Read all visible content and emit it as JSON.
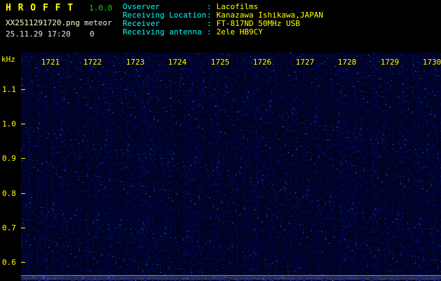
{
  "header": {
    "app_title": "H R O F F T",
    "version": "1.0.0",
    "filename": "XX2511291720.png",
    "mode": "meteor",
    "timestamp": "25.11.29 17:20",
    "echo_count": "0",
    "separator": ":",
    "info_rows": [
      {
        "label": "Ovserver",
        "value": "Lacofilms"
      },
      {
        "label": "Receiving Location",
        "value": "Kanazawa Ishikawa,JAPAN"
      },
      {
        "label": "Receiver",
        "value": "FT-817ND 50MHz USB"
      },
      {
        "label": "Receiving antenna",
        "value": "2ele HB9CY"
      }
    ]
  },
  "chart_data": {
    "type": "heatmap",
    "description": "10-minute radio meteor spectrogram waterfall showing only blue noise floor, no meteor echoes; faint horizontal carrier lines and blue signal-level trace along bottom edge",
    "x_ticks": [
      "1721",
      "1722",
      "1723",
      "1724",
      "1725",
      "1726",
      "1727",
      "1728",
      "1729",
      "1730"
    ],
    "x_is_time_hhmm": true,
    "y_ticks": [
      "1.1",
      "1.0",
      "0.9",
      "0.8",
      "0.7",
      "0.6"
    ],
    "ylabel": "kHz",
    "y_range_khz": [
      0.55,
      1.2
    ],
    "grid": false,
    "colors": {
      "background": "#000018",
      "noise": "#2233aa",
      "tick_label": "#ffff00",
      "carrier_line": "#c8c8dc",
      "level_trace": "#4050e0"
    }
  }
}
